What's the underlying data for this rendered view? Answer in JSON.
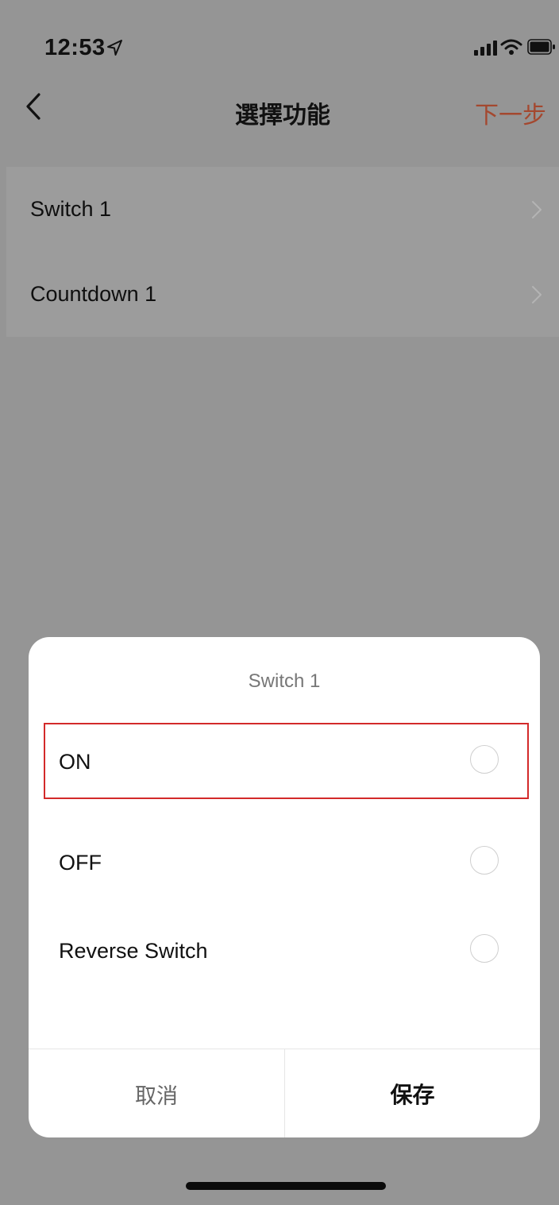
{
  "status_bar": {
    "time": "12:53",
    "icons": [
      "location-arrow-icon",
      "cellular-signal-icon",
      "wifi-icon",
      "battery-icon"
    ]
  },
  "nav": {
    "title": "選擇功能",
    "next_label": "下一步",
    "back_icon": "chevron-left-icon"
  },
  "list": {
    "items": [
      {
        "label": "Switch 1",
        "icon": "chevron-right-icon"
      },
      {
        "label": "Countdown 1",
        "icon": "chevron-right-icon"
      }
    ]
  },
  "dialog": {
    "title": "Switch 1",
    "options": [
      {
        "label": "ON",
        "selected": false
      },
      {
        "label": "OFF",
        "selected": false
      },
      {
        "label": "Reverse Switch",
        "selected": false
      }
    ],
    "cancel_label": "取消",
    "save_label": "保存"
  },
  "colors": {
    "accent": "#a4482f",
    "overlay": "#959595",
    "highlight": "#d32a2a"
  }
}
